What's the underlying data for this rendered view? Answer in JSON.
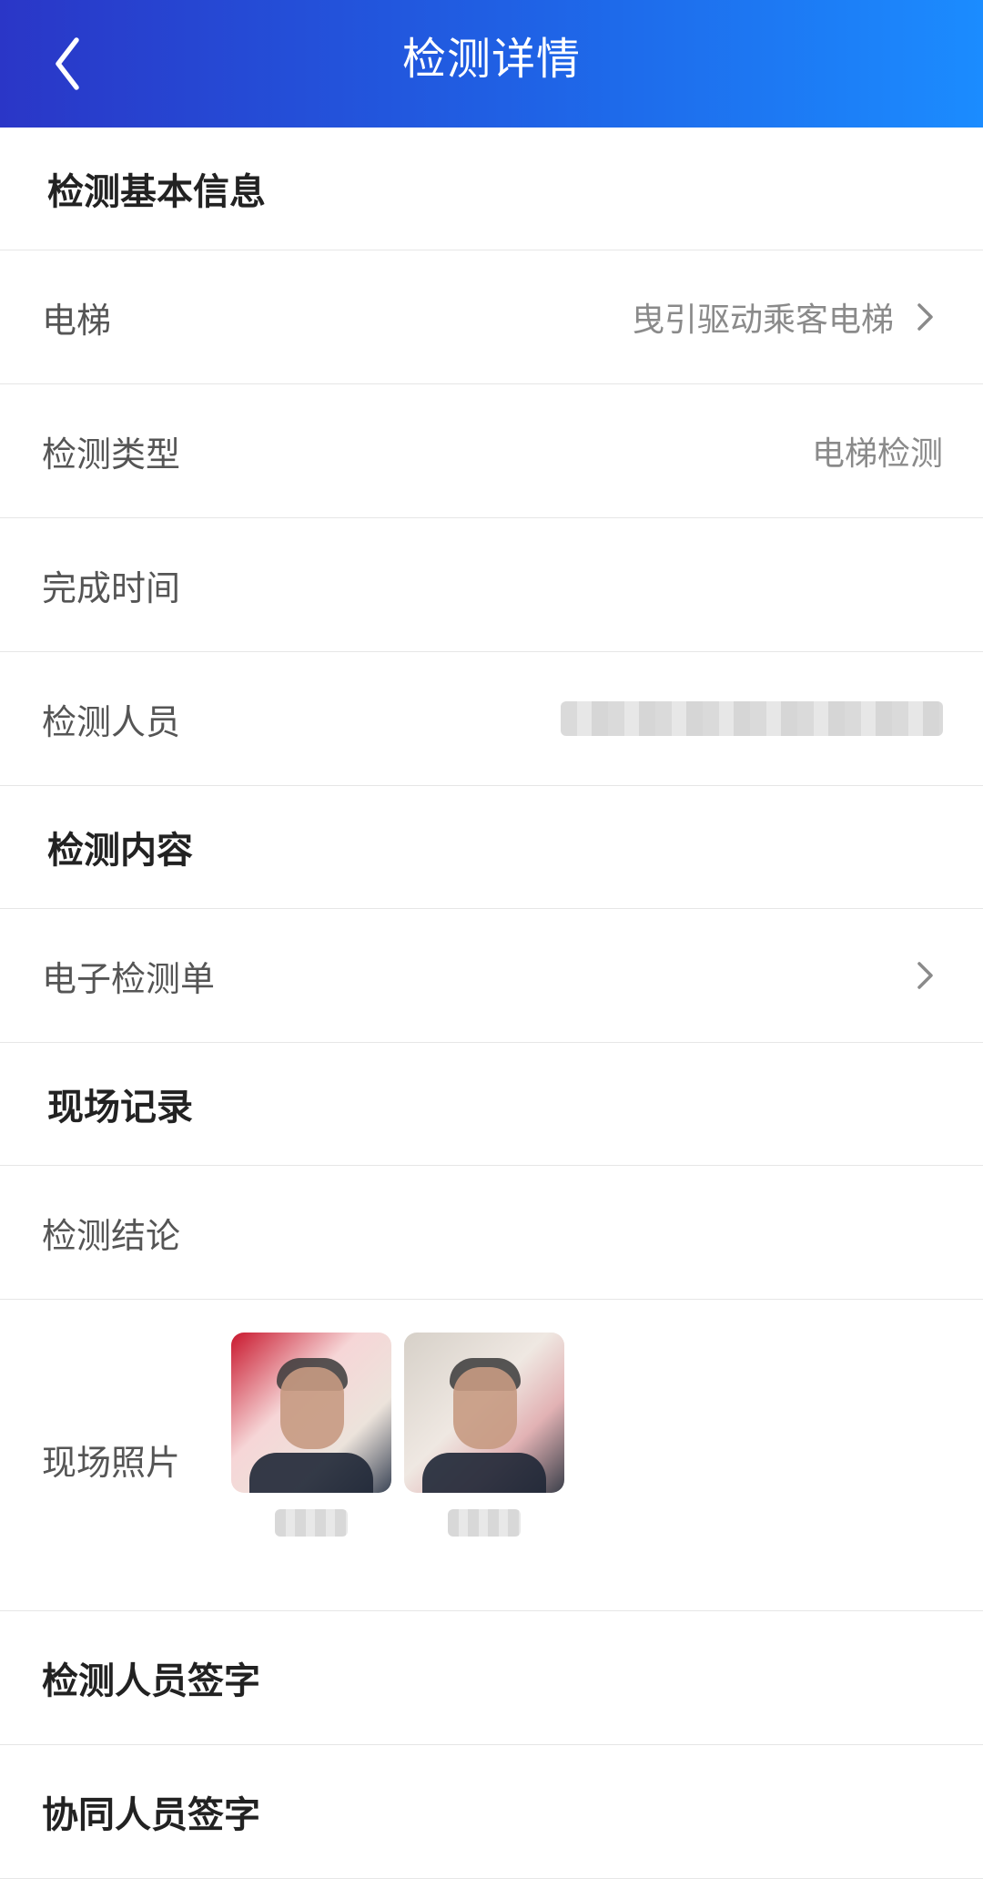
{
  "header": {
    "title": "检测详情",
    "back_icon": "chevron-left-icon"
  },
  "basic_info": {
    "section_title": "检测基本信息",
    "elevator": {
      "label": "电梯",
      "value": "曳引驱动乘客电梯"
    },
    "type": {
      "label": "检测类型",
      "value": "电梯检测"
    },
    "completion_time": {
      "label": "完成时间",
      "value": ""
    },
    "inspector": {
      "label": "检测人员",
      "value_redacted": true
    }
  },
  "content": {
    "section_title": "检测内容",
    "electronic_form": {
      "label": "电子检测单"
    }
  },
  "site_record": {
    "section_title": "现场记录",
    "conclusion": {
      "label": "检测结论",
      "value": ""
    },
    "photos": {
      "label": "现场照片",
      "count": 2
    }
  },
  "signatures": {
    "inspector_sign": "检测人员签字",
    "assistant_sign": "协同人员签字"
  },
  "colors": {
    "header_gradient_start": "#2a36c7",
    "header_gradient_end": "#1b8cff",
    "divider": "#e6e6e6",
    "label_text": "#555555",
    "value_text": "#8a8a8a",
    "section_text": "#222222"
  }
}
